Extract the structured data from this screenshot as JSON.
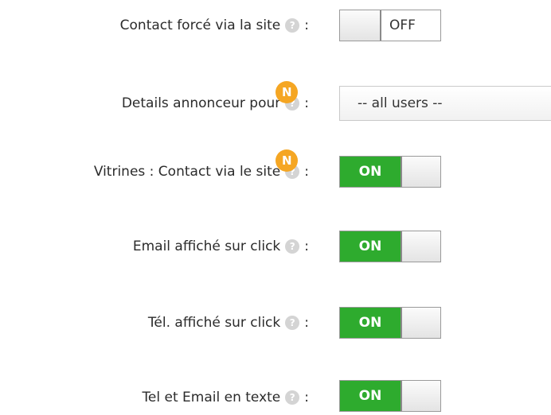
{
  "settings": [
    {
      "label": "Contact forcé via la site",
      "help_icon": "?",
      "colon": ":",
      "control": "toggle",
      "state_label": "OFF",
      "is_new": false
    },
    {
      "label": "Details annonceur pour",
      "help_icon": "?",
      "colon": ":",
      "control": "select",
      "selected_value": "-- all users --",
      "is_new": true,
      "badge": "N"
    },
    {
      "label": "Vitrines : Contact via le site",
      "help_icon": "?",
      "colon": ":",
      "control": "toggle",
      "state_label": "ON",
      "is_new": true,
      "badge": "N"
    },
    {
      "label": "Email affiché sur click",
      "help_icon": "?",
      "colon": ":",
      "control": "toggle",
      "state_label": "ON",
      "is_new": false
    },
    {
      "label": "Tél. affiché sur click",
      "help_icon": "?",
      "colon": ":",
      "control": "toggle",
      "state_label": "ON",
      "is_new": false
    },
    {
      "label": "Tel et Email en texte",
      "help_icon": "?",
      "colon": ":",
      "control": "toggle",
      "state_label": "ON",
      "is_new": false
    }
  ],
  "colors": {
    "on_green": "#2eab2e",
    "new_badge_orange": "#f5a623",
    "help_icon_gray": "#d4d4d4"
  }
}
